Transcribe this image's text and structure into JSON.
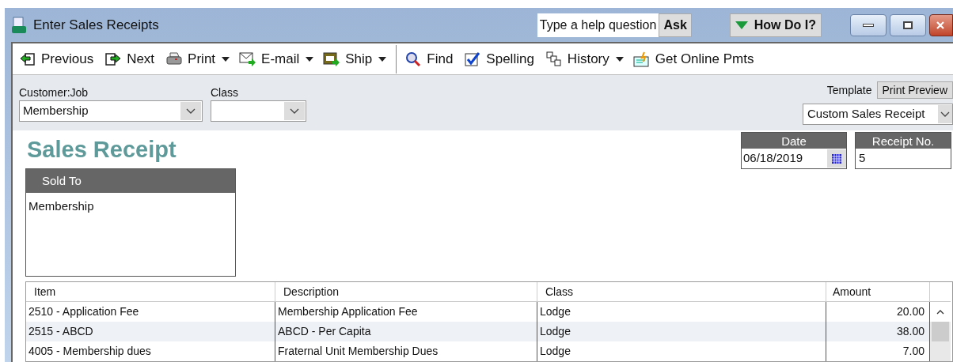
{
  "window": {
    "title": "Enter Sales Receipts"
  },
  "help": {
    "placeholder": "Type a help question",
    "ask": "Ask",
    "how_do_i": "How Do I?"
  },
  "toolbar": [
    {
      "kind": "prev",
      "label": "Previous",
      "dropdown": false
    },
    {
      "kind": "next",
      "label": "Next",
      "dropdown": false
    },
    {
      "kind": "print",
      "label": "Print",
      "dropdown": true
    },
    {
      "kind": "email",
      "label": "E-mail",
      "dropdown": true
    },
    {
      "kind": "ship",
      "label": "Ship",
      "dropdown": true,
      "separator_after": true
    },
    {
      "kind": "find",
      "label": "Find",
      "dropdown": false
    },
    {
      "kind": "spelling",
      "label": "Spelling",
      "dropdown": false
    },
    {
      "kind": "history",
      "label": "History",
      "dropdown": true
    },
    {
      "kind": "pmts",
      "label": "Get Online Pmts",
      "dropdown": false
    }
  ],
  "customer_job": {
    "label": "Customer:Job",
    "value": "Membership"
  },
  "class_field": {
    "label": "Class"
  },
  "template": {
    "label": "Template",
    "print_preview": "Print Preview",
    "value": "Custom Sales Receipt"
  },
  "form_title": "Sales Receipt",
  "date": {
    "label": "Date",
    "value": "06/18/2019"
  },
  "receipt_no": {
    "label": "Receipt No.",
    "value": "5"
  },
  "sold_to": {
    "label": "Sold To",
    "value": "Membership"
  },
  "table": {
    "columns": [
      "Item",
      "Description",
      "Class",
      "Amount"
    ],
    "rows": [
      [
        "2510 - Application Fee",
        "Membership Application Fee",
        "Lodge",
        "20.00"
      ],
      [
        "2515 - ABCD",
        "ABCD - Per Capita",
        "Lodge",
        "38.00"
      ],
      [
        "4005 - Membership dues",
        "Fraternal Unit Membership Dues",
        "Lodge",
        "7.00"
      ]
    ]
  }
}
